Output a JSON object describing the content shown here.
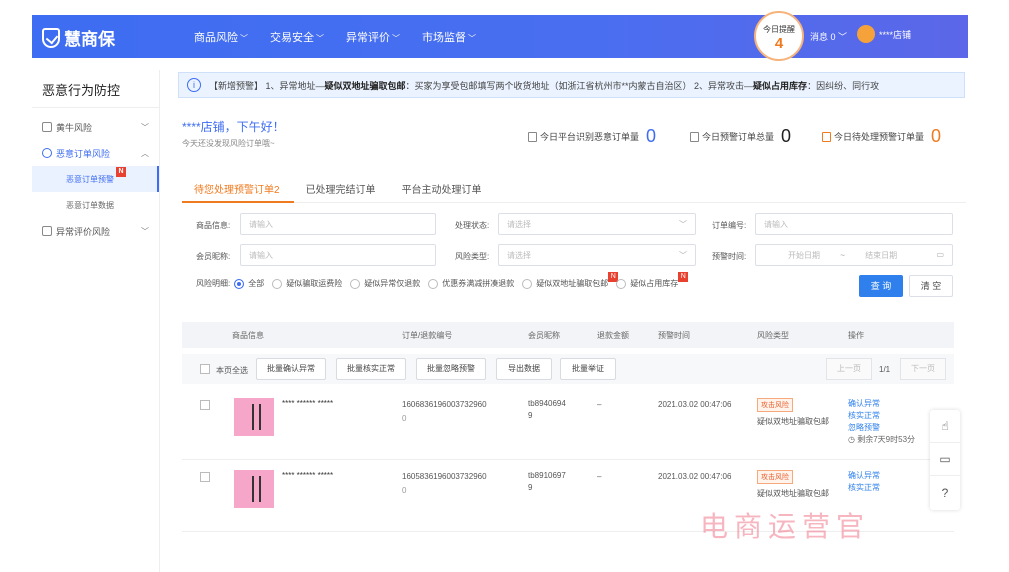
{
  "header": {
    "logo": "慧商保",
    "nav": [
      "商品风险",
      "交易安全",
      "异常评价",
      "市场监督"
    ],
    "alert_label": "今日提醒",
    "alert_count": "4",
    "message_label": "消息 0",
    "user_name": "****店铺"
  },
  "sidebar": {
    "title": "恶意行为防控",
    "items": [
      {
        "label": "黄牛风险"
      },
      {
        "label": "恶意订单风险"
      },
      {
        "label": "异常评价风险"
      }
    ],
    "subitems": [
      {
        "label": "恶意订单预警"
      },
      {
        "label": "恶意订单数据"
      }
    ],
    "new_badge": "N"
  },
  "notice": {
    "info_icon": "i",
    "prefix": "【新增预警】 1、异常地址—",
    "bold1": "疑似双地址骗取包邮",
    "text1": "：买家为享受包邮填写两个收货地址（如浙江省杭州市**内蒙古自治区） 2、异常攻击—",
    "bold2": "疑似占用库存",
    "text2": "：因纠纷、同行攻"
  },
  "greeting": {
    "title": "****店铺，下午好！",
    "subtitle": "今天还没发现风险订单哦~"
  },
  "stats": [
    {
      "label": "今日平台识别恶意订单量",
      "value": "0",
      "color": "#3d6df2"
    },
    {
      "label": "今日预警订单总量",
      "value": "0",
      "color": "#222222"
    },
    {
      "label": "今日待处理预警订单量",
      "value": "0",
      "color": "#f07a1e"
    }
  ],
  "tabs": [
    "待您处理预警订单2",
    "已处理完结订单",
    "平台主动处理订单"
  ],
  "filters": {
    "product_label": "商品信息:",
    "product_placeholder": "请输入",
    "status_label": "处理状态:",
    "status_placeholder": "请选择",
    "order_label": "订单编号:",
    "order_placeholder": "请输入",
    "member_label": "会员昵称:",
    "member_placeholder": "请输入",
    "risk_label": "风险类型:",
    "risk_placeholder": "请选择",
    "time_label": "预警时间:",
    "start_placeholder": "开始日期",
    "date_sep": "~",
    "end_placeholder": "结束日期",
    "detail_label": "风险明细:",
    "radios": [
      "全部",
      "疑似骗取运费险",
      "疑似异常仅退款",
      "优惠券满减拼凑退款",
      "疑似双地址骗取包邮",
      "疑似占用库存"
    ],
    "query": "查 询",
    "clear": "清 空"
  },
  "table": {
    "headers": [
      "商品信息",
      "订单/退款编号",
      "会员昵称",
      "退款金额",
      "预警时间",
      "风险类型",
      "操作"
    ],
    "select_all": "本页全选",
    "batch": [
      "批量确认异常",
      "批量核实正常",
      "批量忽略预警",
      "导出数据",
      "批量举证"
    ],
    "prev": "上一页",
    "page": "1/1",
    "next": "下一页",
    "rows": [
      {
        "product": "**** ****** *****",
        "order": "1606836196003732960",
        "sub": "0",
        "member": "tb8940694 9",
        "amount": "–",
        "time": "2021.03.02 00:47:06",
        "tag": "攻击风险",
        "type": "疑似双地址骗取包邮",
        "ops": [
          "确认异常",
          "核实正常",
          "忽略预警"
        ],
        "countdown": "剩余7天9时53分"
      },
      {
        "product": "**** ****** *****",
        "order": "1605836196003732960",
        "sub": "0",
        "member": "tb8910697 9",
        "amount": "–",
        "time": "2021.03.02 00:47:06",
        "tag": "攻击风险",
        "type": "疑似双地址骗取包邮",
        "ops": [
          "确认异常",
          "核实正常"
        ],
        "countdown": ""
      }
    ]
  },
  "watermark": "电商运营官"
}
